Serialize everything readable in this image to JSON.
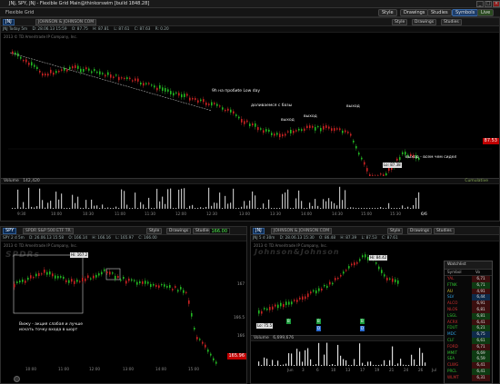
{
  "window": {
    "title": "JNJ, SPY, JNJ - Flexible Grid Main@thinkorswim [build 1848.28]",
    "buttons": {
      "minimize": "_",
      "maximize": "□",
      "close": "×"
    }
  },
  "topbar": {
    "label": "Flexible Grid",
    "buttons": {
      "flip": "",
      "style": "Style",
      "drawings": "Drawings",
      "studies": "Studies",
      "setup": "Setup",
      "pin": ""
    },
    "right_buttons": {
      "symbols": "Symbols",
      "live": "Live",
      "help": ""
    }
  },
  "main_chart": {
    "symbol": "JNJ",
    "quote_line": "JNJ Today 5m",
    "description": "JOHNSON & JOHNSON COM",
    "copyright": "2013 © TD Ameritrade IP Company, Inc.",
    "quote": [
      "D: 28.06.13 15:59",
      "O: 87.75",
      "H: 87.81",
      "L: 87.61",
      "C: 87.63",
      "R: 0.20"
    ],
    "buttons": {
      "style": "Style",
      "drawings": "Drawings",
      "studies": "Studies"
    },
    "price_box": "87.53",
    "low_label": "Lo: 87.38",
    "annotations": {
      "break_low": "9h на пробиte Low day",
      "add": "доливаемся с базы",
      "exit1": "выход",
      "exit2": "выход",
      "exit3": "выход",
      "exit_all": "выход - всем чем сидел"
    },
    "x_ticks": [
      "9:30",
      "10:00",
      "10:30",
      "11:00",
      "11:30",
      "12:00",
      "12:30",
      "13:00",
      "13:30",
      "14:00",
      "14:30",
      "15:00",
      "15:30",
      "6/6"
    ],
    "volume_label": "Volume",
    "volume_value": "142,420",
    "volume_right": "Cumulative"
  },
  "spy_chart": {
    "symbol": "SPY",
    "description": "SPDR S&P 500 ETF TR",
    "quote_line": "SPY 2 d 5m",
    "quote": [
      "D: 26.06.13 15:58",
      "O: 166.14",
      "H: 166.16",
      "L: 165.97",
      "C: 166.00"
    ],
    "buttons": {
      "style": "Style",
      "drawings": "Drawings",
      "studies": "Studies"
    },
    "price_box": "166.00",
    "price_box2": "165.96",
    "copyright": "2013 © TD Ameritrade IP Company, Inc.",
    "watermark": "SPDRs",
    "hi_label": "Hi: 167.2",
    "note": "Вижу - акция слабая и лучше искать точку входа в шорт",
    "y_ticks": [
      "167",
      "166.5",
      "166"
    ],
    "x_ticks": [
      "10:00",
      "11:00",
      "12:00",
      "13:00",
      "14:00",
      "15:00"
    ]
  },
  "jnj2_chart": {
    "symbol": "JNJ",
    "description": "JOHNSON & JOHNSON COM",
    "quote_line": "JNJ 5 d 30m",
    "quote": [
      "D: 28.06.13 15:30",
      "O: 86.48",
      "H: 87.39",
      "L: 87.53",
      "C: 87.61"
    ],
    "buttons": {
      "style": "Style",
      "drawings": "Drawings",
      "studies": "Studies"
    },
    "copyright": "2013 © TD Ameritrade IP Company, Inc.",
    "watermark": "Johnson&Johnson",
    "hi_label": "Hi: 84.42",
    "lo_label": "Lo: 75.5",
    "volume_label": "Volume",
    "volume_value": "6,699,676",
    "x_ticks": [
      "Jun",
      "3",
      "6",
      "10",
      "13",
      "17",
      "19",
      "21",
      "24",
      "26",
      "Jul"
    ],
    "dividend_markers": [
      "B",
      "B",
      "D",
      "B",
      "D"
    ]
  },
  "watchlist": {
    "title": "Watchlist",
    "columns": {
      "symbol": "Symbol",
      "value": "Vo"
    },
    "rows": [
      {
        "symbol": "YAL",
        "value": "6,71",
        "color": "#d03030"
      },
      {
        "symbol": "FTNK",
        "value": "6,71",
        "color": "#30c030"
      },
      {
        "symbol": "AU",
        "value": "4,91",
        "color": "#d0c030"
      },
      {
        "symbol": "SLV",
        "value": "6,44",
        "color": "#30a0e0"
      },
      {
        "symbol": "ALCO",
        "value": "6,91",
        "color": "#d03030"
      },
      {
        "symbol": "NLOS",
        "value": "6,81",
        "color": "#d03030"
      },
      {
        "symbol": "LSGL",
        "value": "6,81",
        "color": "#30c030"
      },
      {
        "symbol": "ACRX",
        "value": "6,41",
        "color": "#d03030"
      },
      {
        "symbol": "FDUT",
        "value": "6,21",
        "color": "#30c030"
      },
      {
        "symbol": "MDC",
        "value": "6,75",
        "color": "#30a0e0"
      },
      {
        "symbol": "CLF",
        "value": "6,61",
        "color": "#30c030"
      },
      {
        "symbol": "FORD",
        "value": "6,71",
        "color": "#d03030"
      },
      {
        "symbol": "MMIT",
        "value": "6,69",
        "color": "#30c030"
      },
      {
        "symbol": "SEA",
        "value": "6,59",
        "color": "#30c030"
      },
      {
        "symbol": "CLWG",
        "value": "6,41",
        "color": "#d03030"
      },
      {
        "symbol": "PRCL",
        "value": "6,41",
        "color": "#30c030"
      },
      {
        "symbol": "WLMT",
        "value": "6,31",
        "color": "#d03030"
      }
    ]
  }
}
